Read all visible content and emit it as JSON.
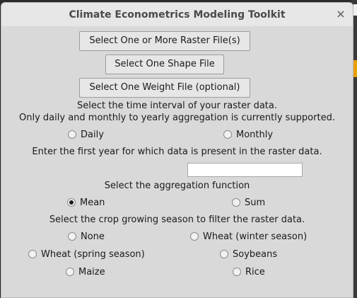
{
  "window": {
    "title": "Climate Econometrics Modeling Toolkit",
    "close_glyph": "×"
  },
  "buttons": {
    "raster": "Select One or More Raster File(s)",
    "shape": "Select One Shape File",
    "weight": "Select One Weight File (optional)"
  },
  "time_interval": {
    "prompt_line1": "Select the time interval of your raster data.",
    "prompt_line2": "Only daily and monthly to yearly aggregation is currently supported.",
    "options": [
      {
        "label": "Daily",
        "selected": false
      },
      {
        "label": "Monthly",
        "selected": false
      }
    ]
  },
  "first_year": {
    "prompt": "Enter the first year for which data is present in the raster data.",
    "value": ""
  },
  "aggregation": {
    "prompt": "Select the aggregation function",
    "options": [
      {
        "label": "Mean",
        "selected": true
      },
      {
        "label": "Sum",
        "selected": false
      }
    ]
  },
  "crop_season": {
    "prompt": "Select the crop growing season to filter the raster data.",
    "options": [
      {
        "label": "None",
        "selected": false
      },
      {
        "label": "Wheat (winter season)",
        "selected": false
      },
      {
        "label": "Wheat (spring season)",
        "selected": false
      },
      {
        "label": "Soybeans",
        "selected": false
      },
      {
        "label": "Maize",
        "selected": false
      },
      {
        "label": "Rice",
        "selected": false
      }
    ]
  }
}
